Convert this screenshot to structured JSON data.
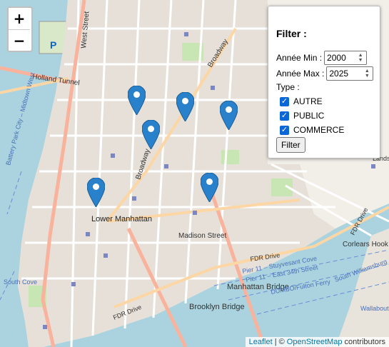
{
  "map": {
    "labels": {
      "west_street": "West Street",
      "holland_tunnel": "Holland Tunnel",
      "broadway_top": "Broadway",
      "broadway_mid": "Broadway",
      "lower_manhattan": "Lower Manhattan",
      "madison_street": "Madison Street",
      "fdr_drive_right": "FDR Drive",
      "fdr_drive_bottom": "FDR Drive",
      "fdr_drive_left": "FDR Drive",
      "corlears_hook": "Corlears Hook",
      "manhattan_bridge": "Manhattan Bridge",
      "brooklyn_bridge": "Brooklyn Bridge",
      "south_cove": "South Cove",
      "ferry_1": "Pier 11 – Stuyvesant Cove",
      "ferry_2": "Pier 11 – East 34th Street",
      "ferry_3": "DUMBO/Fulton Ferry",
      "ferry_4": "South Williamsburg",
      "ferry_left": "Battery Park City – Midtown West",
      "wallabout": "Wallabout Bay",
      "parking": "P",
      "lands": "Lands"
    },
    "marker_color": "#2a81cb"
  },
  "zoom": {
    "in_label": "+",
    "out_label": "−"
  },
  "filter": {
    "title": "Filter :",
    "year_min_label": "Année Min :",
    "year_min_value": "2000",
    "year_max_label": "Année Max :",
    "year_max_value": "2025",
    "type_label": "Type :",
    "types": [
      "AUTRE",
      "PUBLIC",
      "COMMERCE"
    ],
    "button": "Filter"
  },
  "attribution": {
    "leaflet": "Leaflet",
    "sep": "|",
    "copyright": "©",
    "osm": "OpenStreetMap",
    "contributors": "contributors"
  }
}
